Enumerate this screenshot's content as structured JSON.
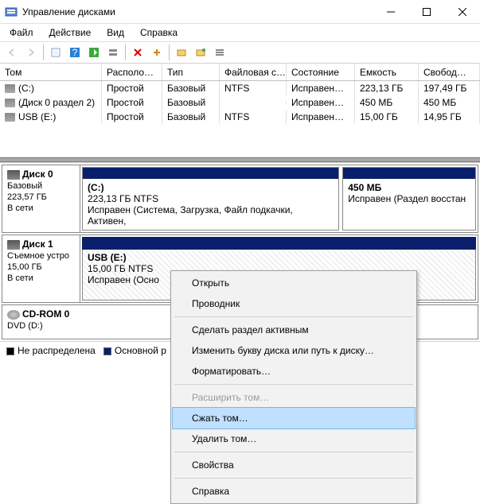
{
  "window": {
    "title": "Управление дисками",
    "sys": {
      "minimize": "—",
      "maximize": "▢",
      "close": "✕"
    }
  },
  "menu": {
    "file": "Файл",
    "action": "Действие",
    "view": "Вид",
    "help": "Справка"
  },
  "columns": {
    "volume": "Том",
    "layout": "Располо…",
    "type": "Тип",
    "fs": "Файловая с…",
    "status": "Состояние",
    "capacity": "Емкость",
    "free": "Свобод…"
  },
  "volumes": [
    {
      "name": "(C:)",
      "layout": "Простой",
      "type": "Базовый",
      "fs": "NTFS",
      "status": "Исправен…",
      "capacity": "223,13 ГБ",
      "free": "197,49 ГБ"
    },
    {
      "name": "(Диск 0 раздел 2)",
      "layout": "Простой",
      "type": "Базовый",
      "fs": "",
      "status": "Исправен…",
      "capacity": "450 МБ",
      "free": "450 МБ"
    },
    {
      "name": "USB (E:)",
      "layout": "Простой",
      "type": "Базовый",
      "fs": "NTFS",
      "status": "Исправен…",
      "capacity": "15,00 ГБ",
      "free": "14,95 ГБ"
    }
  ],
  "disks": {
    "d0": {
      "name": "Диск 0",
      "type": "Базовый",
      "size": "223,57 ГБ",
      "status": "В сети",
      "p1": {
        "name": "(C:)",
        "detail": "223,13 ГБ NTFS",
        "status": "Исправен (Система, Загрузка, Файл подкачки, Активен,"
      },
      "p2": {
        "name": "450 МБ",
        "detail": "",
        "status": "Исправен (Раздел восстан"
      }
    },
    "d1": {
      "name": "Диск 1",
      "type": "Съемное устро",
      "size": "15,00 ГБ",
      "status": "В сети",
      "p1": {
        "name": "USB  (E:)",
        "detail": "15,00 ГБ NTFS",
        "status": "Исправен (Осно"
      }
    },
    "cd": {
      "name": "CD-ROM 0",
      "type": "DVD (D:)"
    }
  },
  "legend": {
    "unallocated": "Не распределена",
    "primary": "Основной р"
  },
  "context_menu": {
    "open": "Открыть",
    "explorer": "Проводник",
    "active": "Сделать раздел активным",
    "change_letter": "Изменить букву диска или путь к диску…",
    "format": "Форматировать…",
    "extend": "Расширить том…",
    "shrink": "Сжать том…",
    "delete": "Удалить том…",
    "properties": "Свойства",
    "help": "Справка"
  }
}
